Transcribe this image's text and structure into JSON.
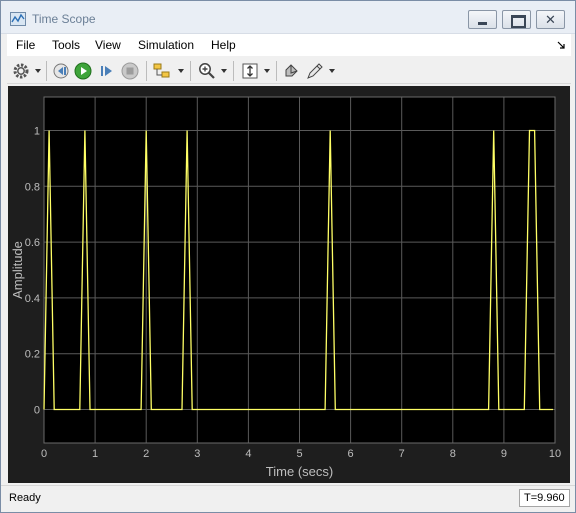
{
  "window": {
    "title": "Time Scope"
  },
  "menubar": {
    "items": [
      "File",
      "Tools",
      "View",
      "Simulation",
      "Help"
    ]
  },
  "toolbar": {
    "icons": [
      "gear-icon",
      "step-back-icon",
      "run-icon",
      "step-forward-icon",
      "stop-icon",
      "signal-select-icon",
      "zoom-in-icon",
      "autoscale-icon",
      "highlight-icon",
      "measure-icon"
    ]
  },
  "colors": {
    "plot_bg": "#000000",
    "figure_bg": "#1e1e1e",
    "trace": "#ffff66",
    "grid": "#5a5a5a",
    "text": "#bdbdbd"
  },
  "status": {
    "text": "Ready",
    "time": "T=9.960"
  },
  "chart_data": {
    "type": "line",
    "title": "",
    "xlabel": "Time (secs)",
    "ylabel": "Amplitude",
    "xlim": [
      0,
      10
    ],
    "ylim": [
      -0.12,
      1.12
    ],
    "xticks": [
      "0",
      "1",
      "2",
      "3",
      "4",
      "5",
      "6",
      "7",
      "8",
      "9",
      "10"
    ],
    "yticks": [
      "0",
      "0.2",
      "0.4",
      "0.6",
      "0.8",
      "1"
    ],
    "grid": true,
    "series": [
      {
        "x": [
          0,
          0.1,
          0.2,
          0.3,
          0.4,
          0.5,
          0.6,
          0.7,
          0.8,
          0.9,
          1.0,
          1.1,
          1.2,
          1.3,
          1.4,
          1.5,
          1.6,
          1.7,
          1.8,
          1.9,
          2.0,
          2.1,
          2.2,
          2.3,
          2.4,
          2.5,
          2.6,
          2.7,
          2.8,
          2.9,
          3.0,
          3.1,
          3.2,
          3.3,
          3.4,
          3.5,
          3.6,
          3.7,
          3.8,
          3.9,
          4.0,
          4.1,
          4.2,
          4.3,
          4.4,
          4.5,
          4.6,
          4.7,
          4.8,
          4.9,
          5.0,
          5.1,
          5.2,
          5.3,
          5.4,
          5.5,
          5.6,
          5.7,
          5.8,
          5.9,
          6.0,
          6.1,
          6.2,
          6.3,
          6.4,
          6.5,
          6.6,
          6.7,
          6.8,
          6.9,
          7.0,
          7.1,
          7.2,
          7.3,
          7.4,
          7.5,
          7.6,
          7.7,
          7.8,
          7.9,
          8.0,
          8.1,
          8.2,
          8.3,
          8.4,
          8.5,
          8.6,
          8.7,
          8.8,
          8.9,
          9.0,
          9.1,
          9.2,
          9.3,
          9.4,
          9.5,
          9.6,
          9.7,
          9.8,
          9.9,
          9.96
        ],
        "y": [
          0,
          1,
          0,
          0,
          0,
          0,
          0,
          0,
          1,
          0,
          0,
          0,
          0,
          0,
          0,
          0,
          0,
          0,
          0,
          0,
          1,
          0,
          0,
          0,
          0,
          0,
          0,
          0,
          1,
          0,
          0,
          0,
          0,
          0,
          0,
          0,
          0,
          0,
          0,
          0,
          0,
          0,
          0,
          0,
          0,
          0,
          0,
          0,
          0,
          0,
          0,
          0,
          0,
          0,
          0,
          0,
          1,
          0,
          0,
          0,
          0,
          0,
          0,
          0,
          0,
          0,
          0,
          0,
          0,
          0,
          0,
          0,
          0,
          0,
          0,
          0,
          0,
          0,
          0,
          0,
          0,
          0,
          0,
          0,
          0,
          0,
          0,
          0,
          1,
          0,
          0,
          0,
          0,
          0,
          0,
          1,
          1,
          0,
          0,
          0,
          0
        ]
      }
    ]
  }
}
